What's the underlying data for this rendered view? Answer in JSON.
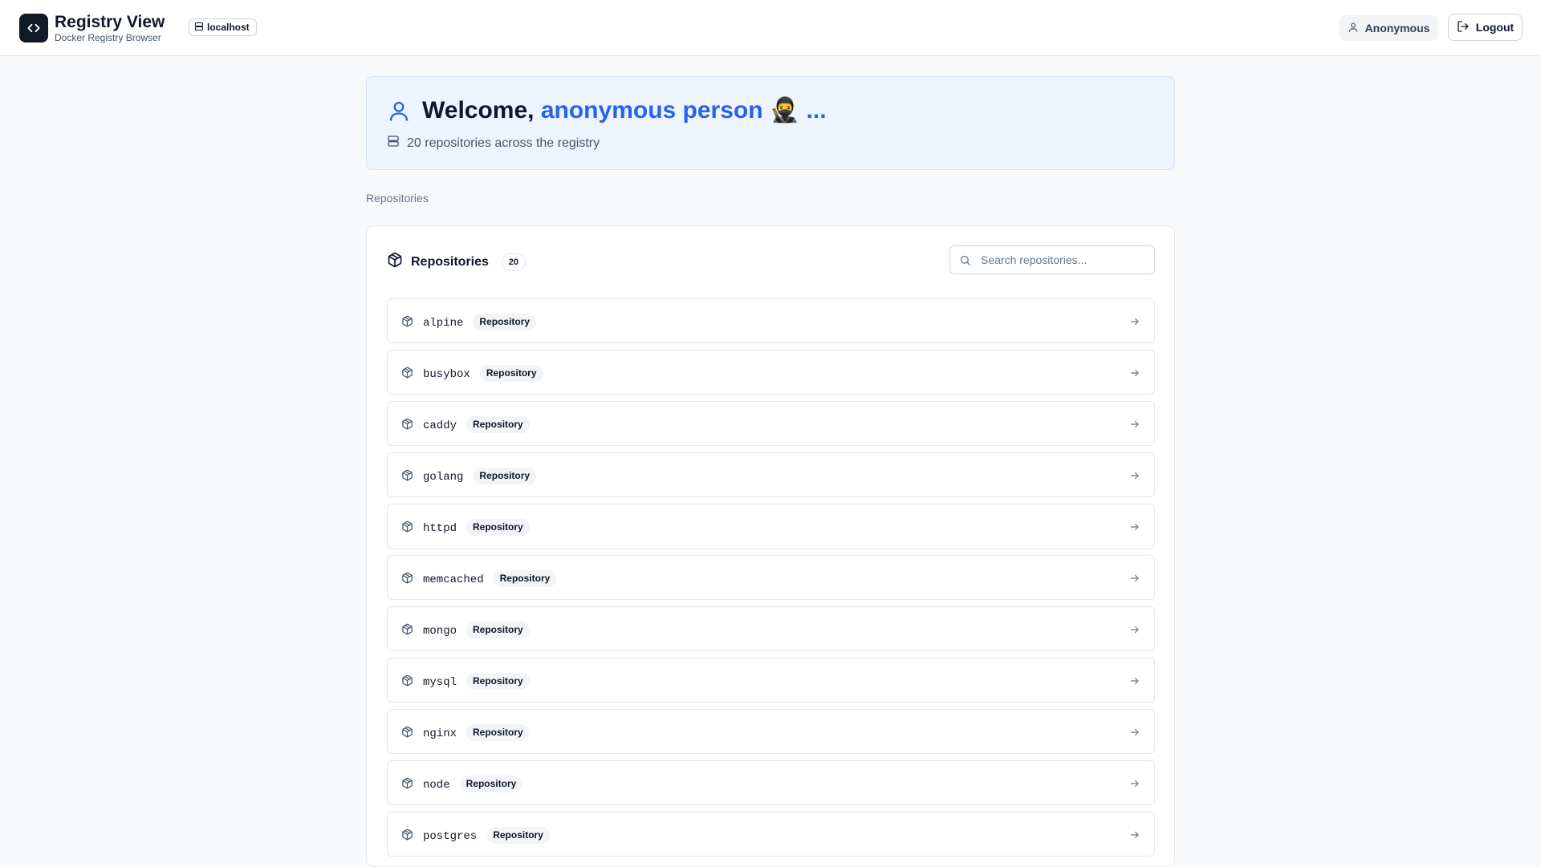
{
  "header": {
    "title": "Registry View",
    "subtitle": "Docker Registry Browser",
    "host": "localhost",
    "user": "Anonymous",
    "logout_label": "Logout"
  },
  "welcome": {
    "prefix": "Welcome, ",
    "name": "anonymous person 🥷 ...",
    "subtitle": "20 repositories across the registry"
  },
  "breadcrumb": "Repositories",
  "repositories": {
    "title": "Repositories",
    "count": "20",
    "search_placeholder": "Search repositories...",
    "tag_label": "Repository",
    "items": [
      {
        "name": "alpine"
      },
      {
        "name": "busybox"
      },
      {
        "name": "caddy"
      },
      {
        "name": "golang"
      },
      {
        "name": "httpd"
      },
      {
        "name": "memcached"
      },
      {
        "name": "mongo"
      },
      {
        "name": "mysql"
      },
      {
        "name": "nginx"
      },
      {
        "name": "node"
      },
      {
        "name": "postgres"
      }
    ]
  },
  "colors": {
    "accent": "#2563eb",
    "logo_bg": "#111827",
    "welcome_bg": "#eef4fd"
  }
}
